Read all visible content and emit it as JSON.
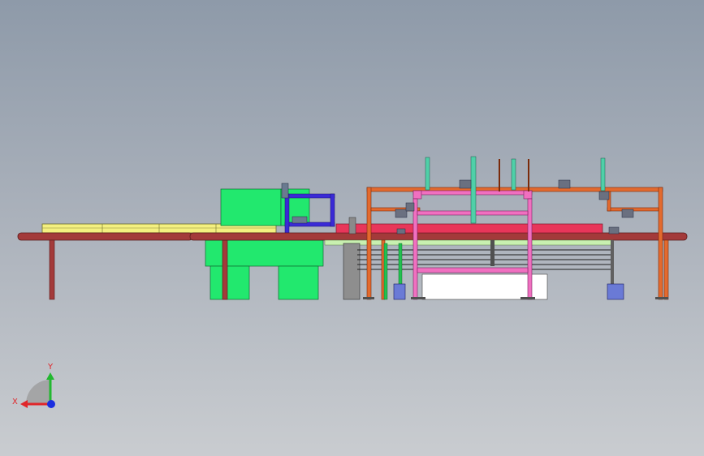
{
  "view": {
    "background_top": "#8e9aa9",
    "background_bottom": "#c9ccd0"
  },
  "triad": {
    "x_label": "X",
    "y_label": "Y",
    "x_color": "#e0262a",
    "y_color": "#22b830",
    "z_color": "#1a2ee0"
  },
  "assembly": {
    "beam_color": "#a33a3a",
    "green_machine_color": "#22e86e",
    "blue_frame_color": "#3a2ad6",
    "orange_frame_color": "#e36a2e",
    "pink_frame_color": "#f070c0",
    "yellow_rails_color": "#f4f080",
    "teal_rod_color": "#4fd0a8",
    "white_box_color": "#ffffff"
  }
}
